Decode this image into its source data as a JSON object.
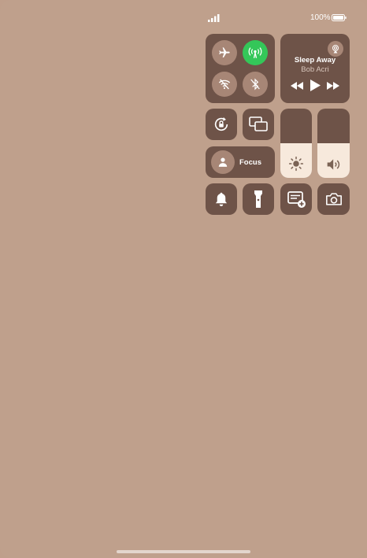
{
  "status_bar": {
    "battery_percent": "100%"
  },
  "connectivity": {
    "airplane_mode": false,
    "cellular_data": true,
    "wifi": false,
    "bluetooth": false
  },
  "now_playing": {
    "title": "Sleep Away",
    "artist": "Bob Acri"
  },
  "focus": {
    "label": "Focus"
  },
  "sliders": {
    "brightness": 0.5,
    "volume": 0.5
  },
  "colors": {
    "background": "#bfa08c",
    "tile": "#6e5348",
    "active_green": "#34c759",
    "slider_fill": "#f7e9dc"
  }
}
